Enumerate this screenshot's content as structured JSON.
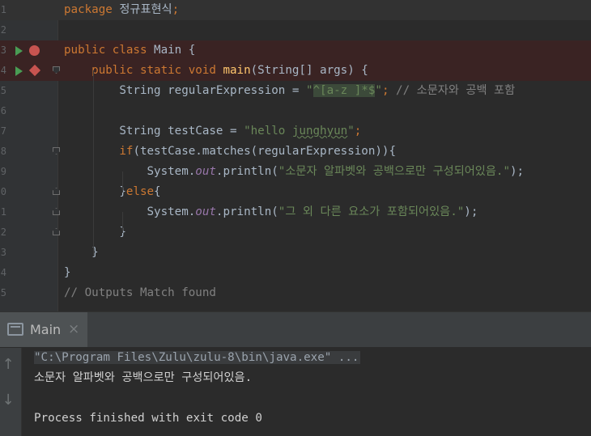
{
  "editor": {
    "line_numbers": [
      "1",
      "2",
      "3",
      "4",
      "5",
      "6",
      "7",
      "8",
      "9",
      "0",
      "1",
      "2",
      "3",
      "4",
      "5"
    ],
    "lines": [
      [
        {
          "t": "package ",
          "c": "kw"
        },
        {
          "t": "정규표현식",
          "c": ""
        },
        {
          "t": ";",
          "c": "kw"
        }
      ],
      [],
      [
        {
          "t": "public class ",
          "c": "kw"
        },
        {
          "t": "Main {",
          "c": ""
        }
      ],
      [
        {
          "t": "    public static void ",
          "c": "kw"
        },
        {
          "t": "main",
          "c": "fn"
        },
        {
          "t": "(String[] args) {",
          "c": ""
        }
      ],
      [
        {
          "t": "        String regularExpression = ",
          "c": ""
        },
        {
          "t": "\"",
          "c": "str"
        },
        {
          "t": "^[a-z ]*$",
          "c": "str re"
        },
        {
          "t": "\"",
          "c": "str"
        },
        {
          "t": "; ",
          "c": "kw"
        },
        {
          "t": "// 소문자와 공백 포함",
          "c": "cm"
        }
      ],
      [],
      [
        {
          "t": "        String testCase = ",
          "c": ""
        },
        {
          "t": "\"hello ",
          "c": "str"
        },
        {
          "t": "junghyun",
          "c": "str wavy"
        },
        {
          "t": "\"",
          "c": "str"
        },
        {
          "t": ";",
          "c": "kw"
        }
      ],
      [
        {
          "t": "        ",
          "c": ""
        },
        {
          "t": "if",
          "c": "kw"
        },
        {
          "t": "(testCase.matches(regularExpression)){",
          "c": ""
        }
      ],
      [
        {
          "t": "            System.",
          "c": ""
        },
        {
          "t": "out",
          "c": "it"
        },
        {
          "t": ".println(",
          "c": ""
        },
        {
          "t": "\"소문자 알파벳와 공백으로만 구성되어있음.\"",
          "c": "str"
        },
        {
          "t": ");",
          "c": ""
        }
      ],
      [
        {
          "t": "        }",
          "c": ""
        },
        {
          "t": "else",
          "c": "kw"
        },
        {
          "t": "{",
          "c": ""
        }
      ],
      [
        {
          "t": "            System.",
          "c": ""
        },
        {
          "t": "out",
          "c": "it"
        },
        {
          "t": ".println(",
          "c": ""
        },
        {
          "t": "\"그 외 다른 요소가 포함되어있음.\"",
          "c": "str"
        },
        {
          "t": ");",
          "c": ""
        }
      ],
      [
        {
          "t": "        }",
          "c": ""
        }
      ],
      [
        {
          "t": "    }",
          "c": ""
        }
      ],
      [
        {
          "t": "}",
          "c": ""
        }
      ],
      [
        {
          "t": "// Outputs Match found",
          "c": "cm"
        }
      ]
    ]
  },
  "run_panel": {
    "tab_label": "Main",
    "tab_close": "×",
    "side_up": "↑",
    "side_down": "↓",
    "console_lines": [
      {
        "text": "\"C:\\Program Files\\Zulu\\zulu-8\\bin\\java.exe\" ...",
        "kind": "cmd"
      },
      {
        "text": "소문자 알파벳와 공백으로만 구성되어있음.",
        "kind": "out"
      },
      {
        "text": "",
        "kind": "out"
      },
      {
        "text": "Process finished with exit code 0",
        "kind": "out"
      }
    ]
  },
  "colors": {
    "keyword": "#cc7832",
    "string": "#6a8759",
    "comment": "#808080",
    "method": "#ffc66d",
    "field": "#9876aa",
    "breakpoint": "#c75450",
    "run": "#499c54"
  }
}
